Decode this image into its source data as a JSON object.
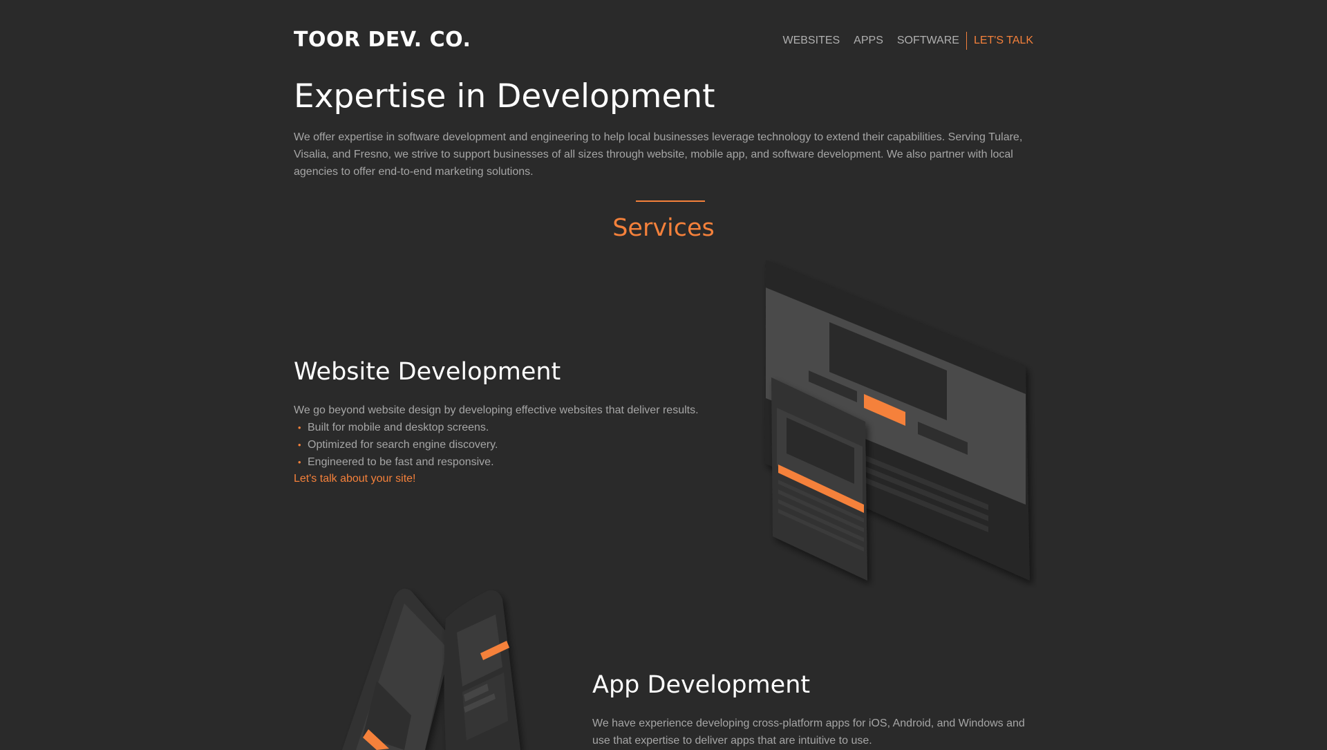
{
  "header": {
    "logo": "TOOR DEV. CO.",
    "nav": [
      "WEBSITES",
      "APPS",
      "SOFTWARE"
    ],
    "cta": "LET'S TALK"
  },
  "hero": {
    "title": "Expertise in Development",
    "intro": "We offer expertise in software development and engineering to help local businesses leverage technology to extend their capabilities. Serving Tulare, Visalia, and Fresno, we strive to support businesses of all sizes through website, mobile app, and software development. We also partner with local agencies to offer end-to-end marketing solutions."
  },
  "services": {
    "heading": "Services",
    "website": {
      "title": "Website Development",
      "desc": "We go beyond website design by developing effective websites that deliver results.",
      "bullets": [
        "Built for mobile and desktop screens.",
        "Optimized for search engine discovery.",
        "Engineered to be fast and responsive."
      ],
      "link": "Let's talk about your site!"
    },
    "app": {
      "title": "App Development",
      "desc": "We have experience developing cross-platform apps for iOS, Android, and Windows and use that expertise to deliver apps that are intuitive to use."
    }
  },
  "colors": {
    "background": "#2a2a2a",
    "accent": "#f5813b",
    "text": "#a6a6a6",
    "heading": "#ffffff"
  }
}
